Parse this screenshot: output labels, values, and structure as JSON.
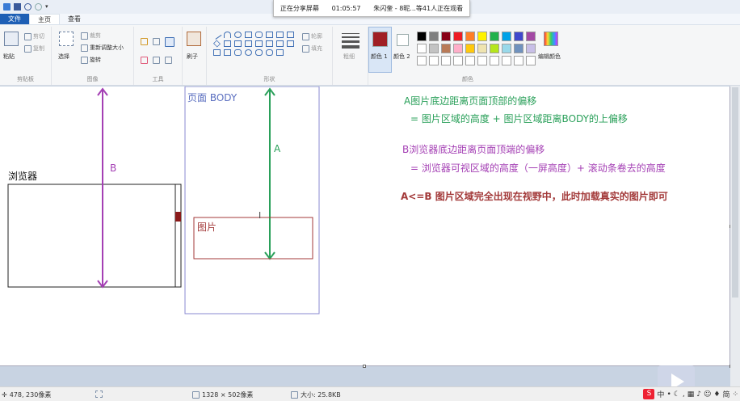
{
  "share": {
    "status": "正在分享屏幕",
    "time": "01:05:57",
    "viewers": "朱闪奎 - 8昵...等41人正在观看"
  },
  "tabs": [
    {
      "label": "文件"
    },
    {
      "label": "主页"
    },
    {
      "label": "查看"
    }
  ],
  "ribbon": {
    "clipboard": {
      "paste": "粘贴",
      "cut": "剪切",
      "copy": "复制",
      "group": "剪贴板"
    },
    "image": {
      "select": "选择",
      "crop": "裁剪",
      "resize": "重新调整大小",
      "rotate": "旋转",
      "group": "图像"
    },
    "tools": {
      "group": "工具"
    },
    "brushes": {
      "label": "刷子"
    },
    "shapes": {
      "outline": "轮廓",
      "fill": "填充",
      "group": "形状"
    },
    "thickness": {
      "label": "粗细"
    },
    "colors": {
      "color1": "颜色 1",
      "color2": "颜色 2",
      "edit": "编辑颜色",
      "group": "颜色",
      "color1_value": "#a01f24",
      "color2_value": "#ffffff",
      "palette_row1": [
        "#000000",
        "#7f7f7f",
        "#880015",
        "#ed1c24",
        "#ff7f27",
        "#fff200",
        "#22b14c",
        "#00a2e8",
        "#3f48cc",
        "#a349a4"
      ],
      "palette_row2": [
        "#ffffff",
        "#c3c3c3",
        "#b97a57",
        "#ffaec9",
        "#ffc90e",
        "#efe4b0",
        "#b5e61d",
        "#99d9ea",
        "#7092be",
        "#c8bfe7"
      ]
    }
  },
  "diagram": {
    "browser_label": "浏览器",
    "b_label": "B",
    "body_label": "页面 BODY",
    "a_label": "A",
    "image_label": "图片",
    "note_a_title": "A图片底边距离页面顶部的偏移",
    "note_a_formula": "= 图片区域的高度 + 图片区域距离BODY的上偏移",
    "note_b_title": "B浏览器底边距离页面顶端的偏移",
    "note_b_formula": "= 浏览器可视区域的高度（一屏高度）+ 滚动条卷去的高度",
    "note_cond": "A<=B 图片区域完全出现在视野中，此时加载真实的图片即可",
    "colors": {
      "green": "#2aa05a",
      "purple": "#a43fb4",
      "red": "#a33a3a",
      "blue": "#5b6fc0"
    }
  },
  "status": {
    "cursor": "478, 230像素",
    "dimensions": "1328 × 502像素",
    "size": "大小: 25.8KB",
    "tray": [
      "中",
      "简"
    ]
  }
}
